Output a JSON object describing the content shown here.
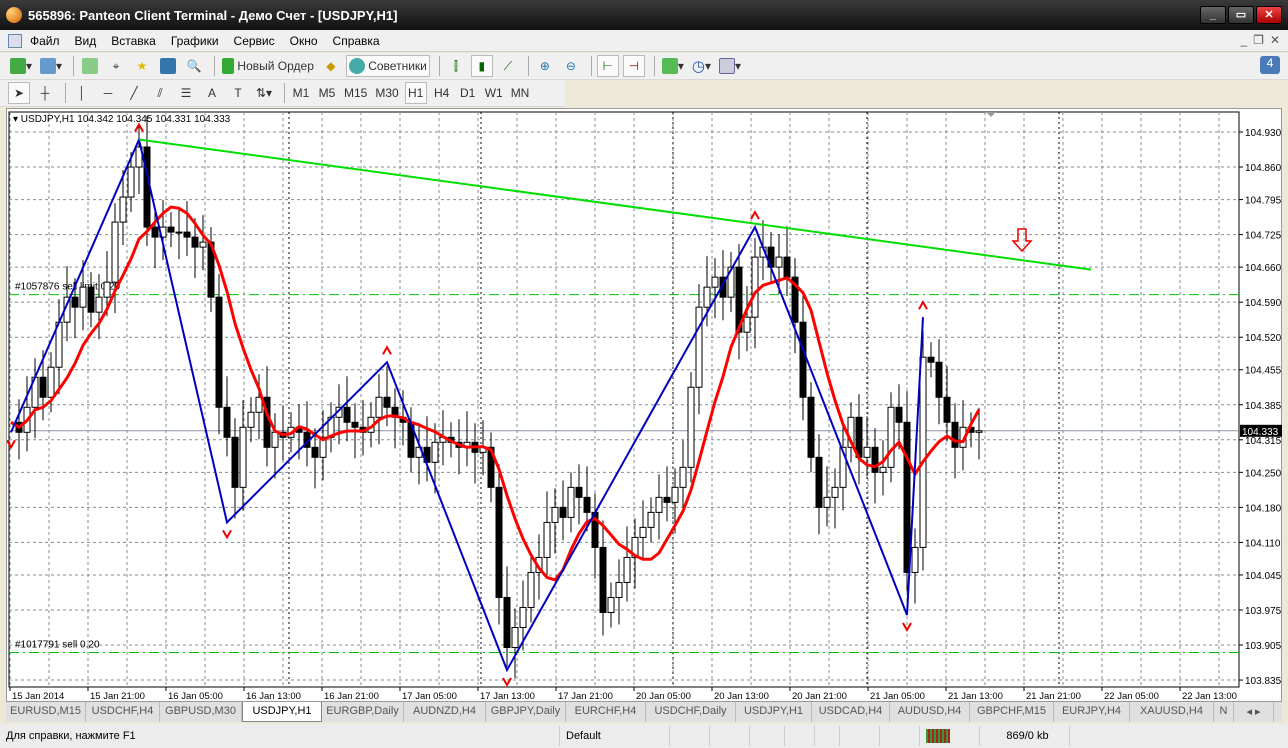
{
  "window": {
    "title": "565896: Panteon Client Terminal - Демо Счет - [USDJPY,H1]"
  },
  "menu": [
    "Файл",
    "Вид",
    "Вставка",
    "Графики",
    "Сервис",
    "Окно",
    "Справка"
  ],
  "toolbar": {
    "new_order": "Новый Ордер",
    "advisors": "Советники",
    "notifications": "4"
  },
  "timeframes": [
    "M1",
    "M5",
    "M15",
    "M30",
    "H1",
    "H4",
    "D1",
    "W1",
    "MN"
  ],
  "active_timeframe": "H1",
  "chart_data": {
    "type": "candlestick",
    "symbol_header": "USDJPY,H1  104.342 104.345 104.331 104.333",
    "current_price": "104.333",
    "ylim": [
      103.835,
      104.965
    ],
    "y_ticks": [
      "104.930",
      "104.860",
      "104.795",
      "104.725",
      "104.660",
      "104.590",
      "104.520",
      "104.455",
      "104.385",
      "104.315",
      "104.250",
      "104.180",
      "104.110",
      "104.045",
      "103.975",
      "103.905",
      "103.835"
    ],
    "x_ticks": [
      "15 Jan 2014",
      "15 Jan 21:00",
      "16 Jan 05:00",
      "16 Jan 13:00",
      "16 Jan 21:00",
      "17 Jan 05:00",
      "17 Jan 13:00",
      "17 Jan 21:00",
      "20 Jan 05:00",
      "20 Jan 13:00",
      "20 Jan 21:00",
      "21 Jan 05:00",
      "21 Jan 13:00",
      "21 Jan 21:00",
      "22 Jan 05:00",
      "22 Jan 13:00"
    ],
    "closes": [
      104.35,
      104.33,
      104.38,
      104.44,
      104.4,
      104.46,
      104.55,
      104.6,
      104.58,
      104.62,
      104.57,
      104.6,
      104.63,
      104.75,
      104.8,
      104.86,
      104.9,
      104.74,
      104.72,
      104.74,
      104.73,
      104.73,
      104.72,
      104.7,
      104.71,
      104.6,
      104.38,
      104.32,
      104.22,
      104.34,
      104.37,
      104.4,
      104.3,
      104.33,
      104.32,
      104.34,
      104.33,
      104.3,
      104.28,
      104.32,
      104.36,
      104.38,
      104.35,
      104.34,
      104.33,
      104.36,
      104.4,
      104.38,
      104.36,
      104.35,
      104.28,
      104.3,
      104.27,
      104.31,
      104.32,
      104.31,
      104.3,
      104.31,
      104.29,
      104.3,
      104.22,
      104.0,
      103.9,
      103.94,
      103.98,
      104.05,
      104.08,
      104.15,
      104.18,
      104.16,
      104.22,
      104.2,
      104.17,
      104.1,
      103.97,
      104.0,
      104.03,
      104.08,
      104.12,
      104.14,
      104.17,
      104.2,
      104.19,
      104.22,
      104.26,
      104.42,
      104.58,
      104.62,
      104.64,
      104.6,
      104.66,
      104.53,
      104.56,
      104.68,
      104.7,
      104.66,
      104.68,
      104.64,
      104.55,
      104.4,
      104.28,
      104.18,
      104.2,
      104.22,
      104.3,
      104.36,
      104.28,
      104.3,
      104.25,
      104.26,
      104.38,
      104.35,
      104.05,
      104.1,
      104.48,
      104.47,
      104.4,
      104.35,
      104.3,
      104.34,
      104.33,
      104.333
    ],
    "ma_period": 8,
    "zigzag": [
      [
        0,
        104.33
      ],
      [
        16,
        104.915
      ],
      [
        27,
        104.15
      ],
      [
        47,
        104.47
      ],
      [
        62,
        103.855
      ],
      [
        93,
        104.74
      ],
      [
        112,
        103.965
      ],
      [
        114,
        104.56
      ]
    ],
    "trendline": [
      [
        16,
        104.915
      ],
      [
        135,
        104.655
      ]
    ],
    "orders": [
      {
        "label": "#1057876 sell limit 0.20",
        "price": 104.605
      },
      {
        "label": "#1017791 sell 0.20",
        "price": 103.89
      }
    ],
    "colors": {
      "ma": "#ff0000",
      "zigzag": "#0000c0",
      "trend": "#00e000",
      "order": "#00c000"
    }
  },
  "tabs": [
    "EURUSD,M15",
    "USDCHF,H4",
    "GBPUSD,M30",
    "USDJPY,H1",
    "EURGBP,Daily",
    "AUDNZD,H4",
    "GBPJPY,Daily",
    "EURCHF,H4",
    "USDCHF,Daily",
    "USDJPY,H1",
    "USDCAD,H4",
    "AUDUSD,H4",
    "GBPCHF,M15",
    "EURJPY,H4",
    "XAUUSD,H4",
    "N"
  ],
  "active_tab": 3,
  "status": {
    "help": "Для справки, нажмите F1",
    "profile": "Default",
    "traffic": "869/0 kb"
  }
}
